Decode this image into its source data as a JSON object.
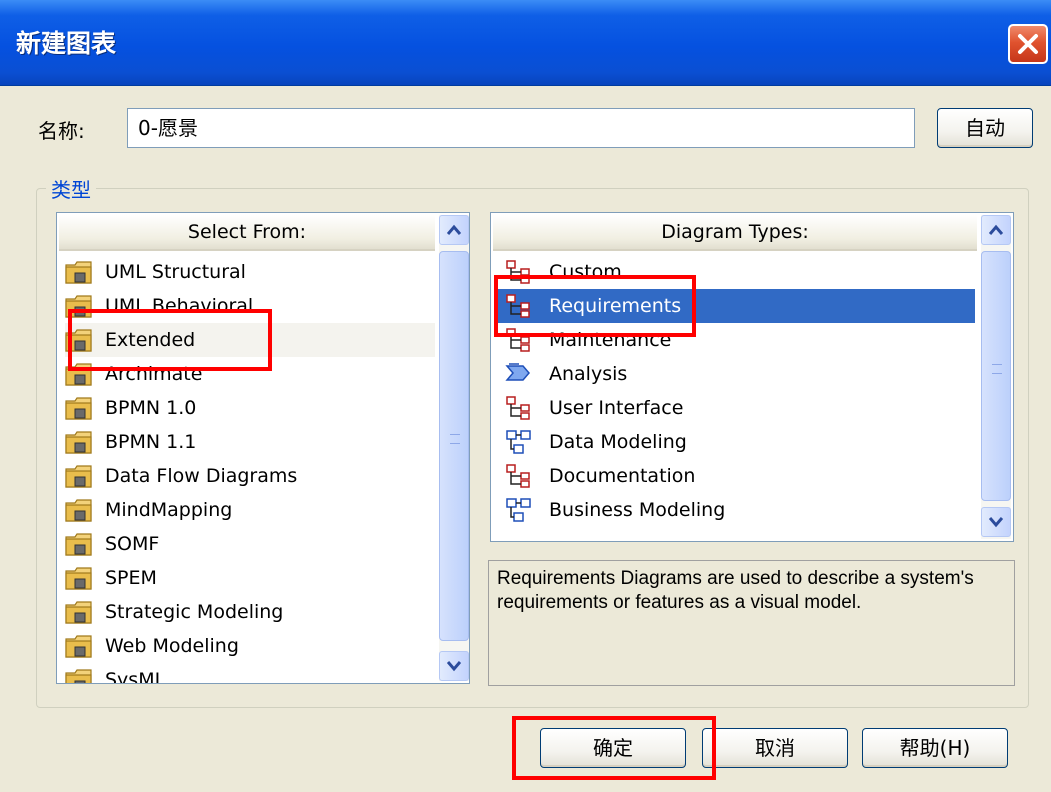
{
  "window": {
    "title": "新建图表"
  },
  "name_field": {
    "label": "名称:",
    "value": "0-愿景"
  },
  "auto_button": "自动",
  "group_label": "类型",
  "select_from": {
    "header": "Select From:",
    "items": [
      "UML Structural",
      "UML Behavioral",
      "Extended",
      "Archimate",
      "BPMN 1.0",
      "BPMN 1.1",
      "Data Flow Diagrams",
      "MindMapping",
      "SOMF",
      "SPEM",
      "Strategic Modeling",
      "Web Modeling",
      "SysML"
    ]
  },
  "diagram_types": {
    "header": "Diagram Types:",
    "selected": "Requirements",
    "items": [
      {
        "label": "Custom",
        "icon": "diagram-tree-icon"
      },
      {
        "label": "Requirements",
        "icon": "diagram-tree-icon"
      },
      {
        "label": "Maintenance",
        "icon": "diagram-tree-icon"
      },
      {
        "label": "Analysis",
        "icon": "analysis-arrow-icon"
      },
      {
        "label": "User Interface",
        "icon": "diagram-tree-icon"
      },
      {
        "label": "Data Modeling",
        "icon": "diagram-flow-icon"
      },
      {
        "label": "Documentation",
        "icon": "diagram-tree-icon"
      },
      {
        "label": "Business Modeling",
        "icon": "diagram-flow-icon"
      }
    ]
  },
  "description": "Requirements Diagrams are used to describe a system's requirements or features as a visual model.",
  "buttons": {
    "ok": "确定",
    "cancel": "取消",
    "help": "帮助(H)"
  },
  "colors": {
    "selection": "#316ac5",
    "highlight": "#ff0000",
    "titlebar": "#0551e0"
  }
}
